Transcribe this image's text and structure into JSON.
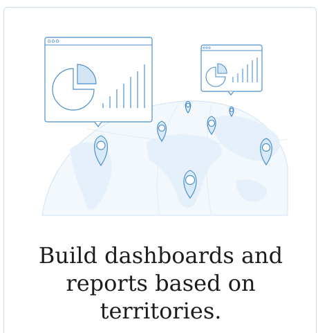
{
  "card": {
    "caption_lines": [
      "Build dashboards and",
      "reports based on",
      "territories."
    ]
  },
  "illustration": {
    "icons": [
      "globe-icon",
      "dashboard-window-icon",
      "pie-chart-icon",
      "bar-chart-icon",
      "map-pin-icon"
    ],
    "colors": {
      "line": "#4b8fcc",
      "fill": "#e3eff9",
      "globe": "#eaf3fb"
    }
  }
}
